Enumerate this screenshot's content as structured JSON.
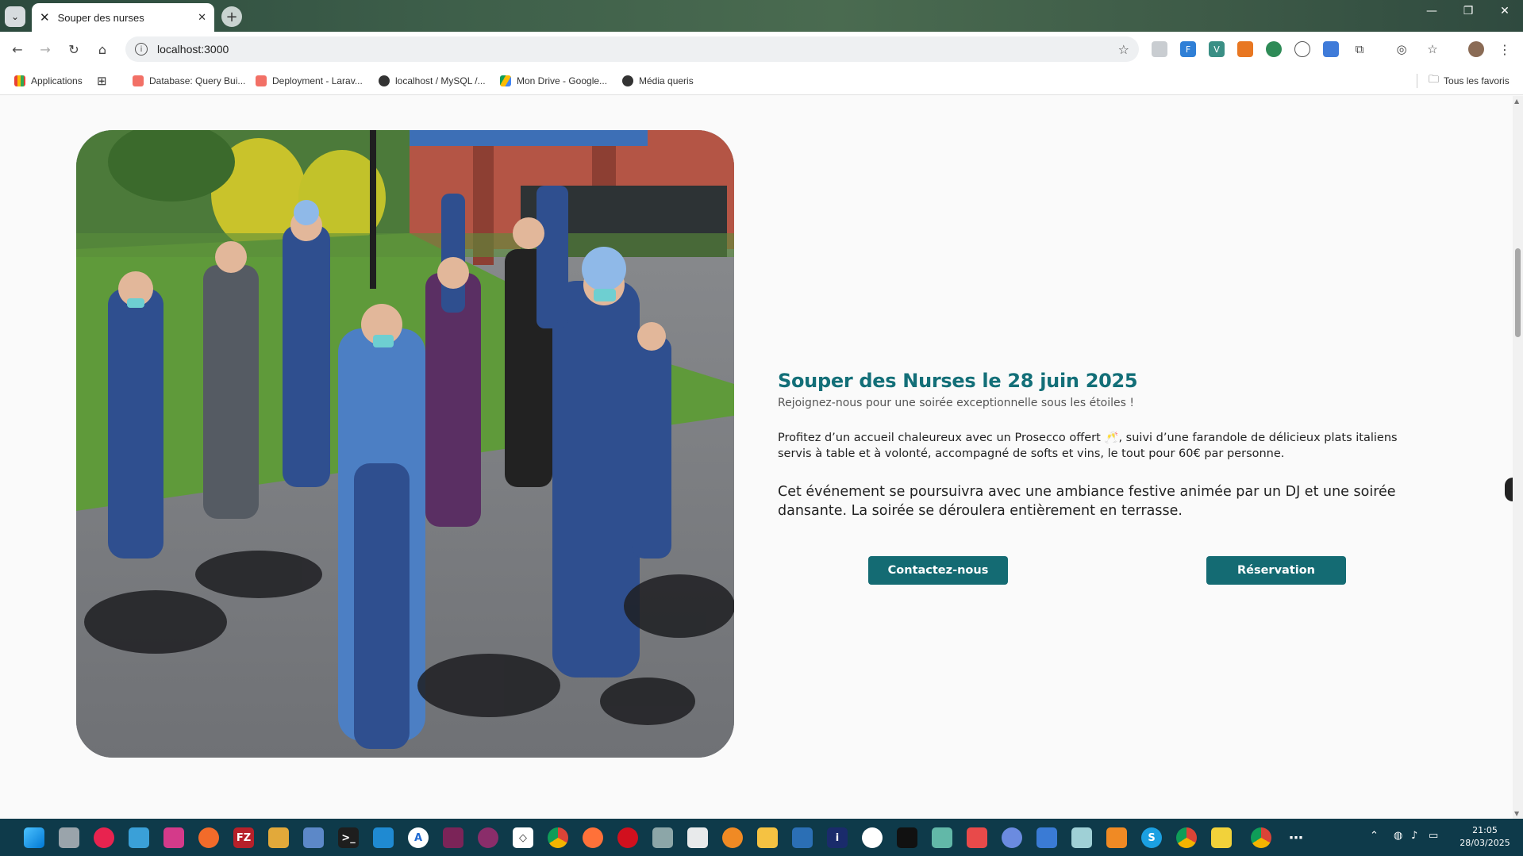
{
  "browser": {
    "tab_title": "Souper des nurses",
    "url": "localhost:3000",
    "bookmarks": [
      {
        "label": "Applications"
      },
      {
        "label": "Database: Query Bui..."
      },
      {
        "label": "Deployment - Larav..."
      },
      {
        "label": "localhost / MySQL /..."
      },
      {
        "label": "Mon Drive - Google..."
      },
      {
        "label": "Média queris"
      }
    ],
    "favorites_label": "Tous les favoris"
  },
  "event": {
    "title": "Souper des Nurses le 28 juin 2025",
    "subtitle": "Rejoignez-nous pour une soirée exceptionnelle sous les étoiles !",
    "description": "Profitez d’un accueil chaleureux avec un Prosecco offert 🥂, suivi d’une farandole de délicieux plats italiens servis à table et à volonté, accompagné de softs et vins, le tout pour 60€ par personne.",
    "description2": "Cet événement se poursuivra avec une ambiance festive animée par un DJ et une soirée dansante. La soirée se déroulera entièrement en terrasse.",
    "contact_button": "Contactez-nous",
    "reservation_button": "Réservation"
  },
  "taskbar": {
    "time": "21:05",
    "date": "28/03/2025"
  },
  "colors": {
    "accent": "#136f78",
    "button": "#146b73",
    "taskbar": "#0e3a4a"
  }
}
